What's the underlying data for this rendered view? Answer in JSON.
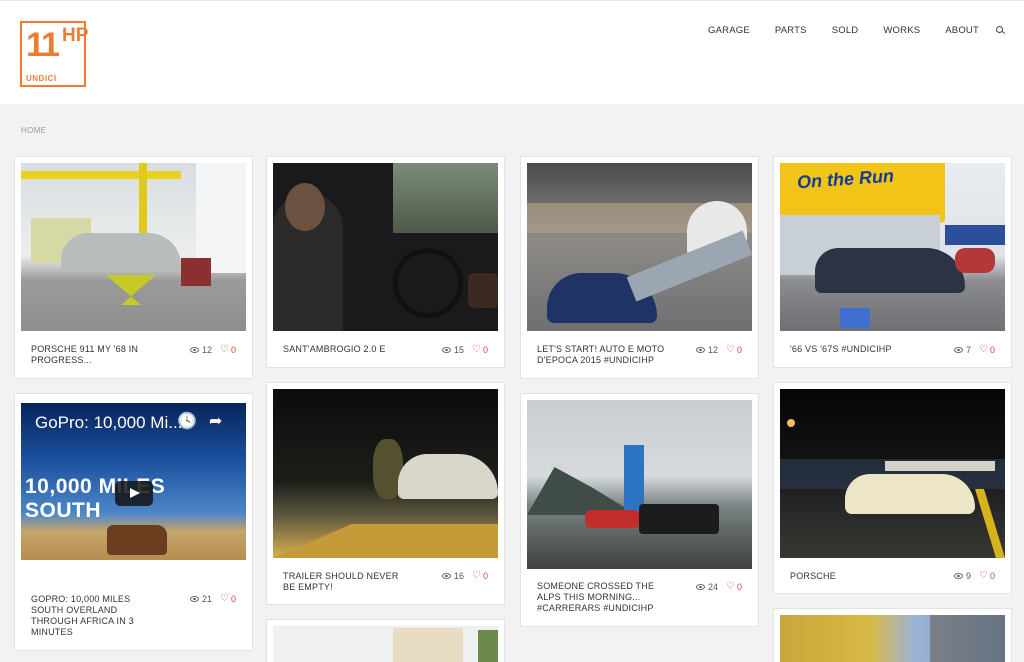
{
  "brand": {
    "logo_number": "11",
    "logo_hp": "HP",
    "logo_sub": "UNDICI"
  },
  "nav": {
    "items": [
      "GARAGE",
      "PARTS",
      "SOLD",
      "WORKS",
      "ABOUT"
    ],
    "search_icon": "search-icon"
  },
  "breadcrumb": "HOME",
  "accent_color": "#ee7d33",
  "like_color": "#e2403a",
  "posts": [
    {
      "caption": "PORSCHE 911 MY '68 IN PROGRESS...",
      "views": "12",
      "likes": "0"
    },
    {
      "caption": "SANT'AMBROGIO 2.0 E",
      "views": "15",
      "likes": "0"
    },
    {
      "caption": "LET'S START! AUTO E MOTO D'EPOCA 2015 #UNDICIHP",
      "views": "12",
      "likes": "0"
    },
    {
      "caption": "'66 VS '67S #UNDICIHP",
      "views": "7",
      "likes": "0"
    },
    {
      "caption": "GOPRO: 10,000 MILES SOUTH OVERLAND THROUGH AFRICA IN 3 MINUTES",
      "views": "21",
      "likes": "0"
    },
    {
      "caption": "TRAILER SHOULD NEVER BE EMPTY!",
      "views": "16",
      "likes": "0"
    },
    {
      "caption": "SOMEONE CROSSED THE ALPS THIS MORNING... #CARRERARS #UNDICIHP",
      "views": "24",
      "likes": "0"
    },
    {
      "caption": "PORSCHE",
      "views": "9",
      "likes": "0"
    }
  ],
  "video": {
    "title": "GoPro: 10,000 Mi...",
    "overlay": "10,000 MILES SOUTH",
    "clock_icon": "clock-icon",
    "share_icon": "share-icon",
    "play_icon": "play-icon"
  },
  "sign_text": "On the Run"
}
